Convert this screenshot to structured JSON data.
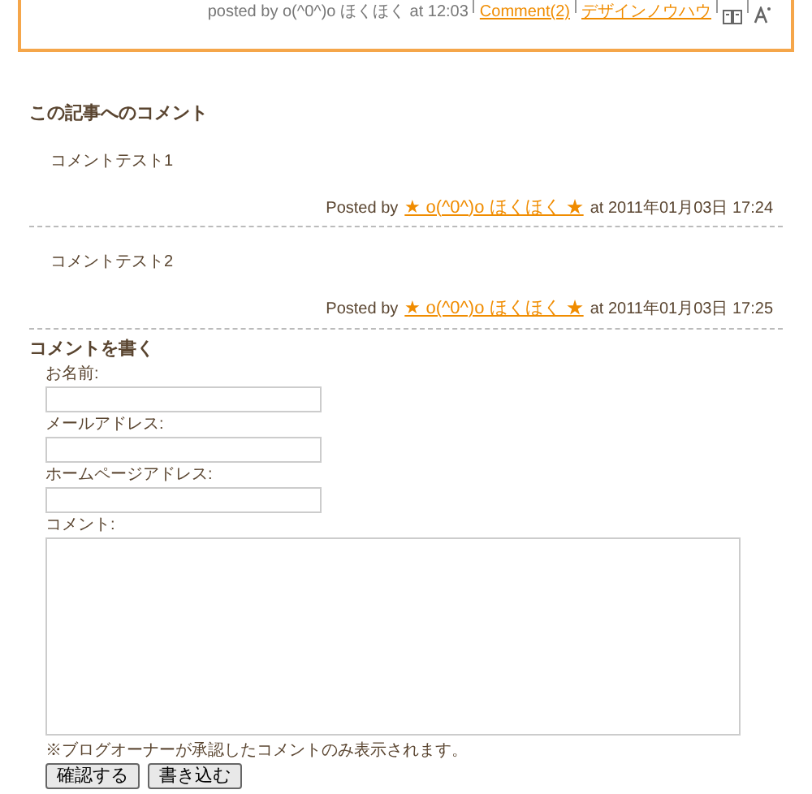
{
  "post_footer": {
    "posted_by": "posted by o(^0^)o ほくほく at 12:03",
    "comment_link": "Comment(2)",
    "category_link": "デザインノウハウ"
  },
  "comments_section": {
    "heading": "この記事へのコメント",
    "comments": [
      {
        "body": "コメントテスト1",
        "posted_prefix": "Posted by",
        "author": "★ o(^0^)o ほくほく ★",
        "date": "at 2011年01月03日 17:24"
      },
      {
        "body": "コメントテスト2",
        "posted_prefix": "Posted by",
        "author": "★ o(^0^)o ほくほく ★",
        "date": "at 2011年01月03日 17:25"
      }
    ]
  },
  "comment_form": {
    "heading": "コメントを書く",
    "fields": [
      {
        "label": "お名前:"
      },
      {
        "label": "メールアドレス:"
      },
      {
        "label": "ホームページアドレス:"
      }
    ],
    "comment_label": "コメント:",
    "note": "※ブログオーナーが承認したコメントのみ表示されます。",
    "buttons": [
      "確認する",
      "書き込む"
    ]
  }
}
